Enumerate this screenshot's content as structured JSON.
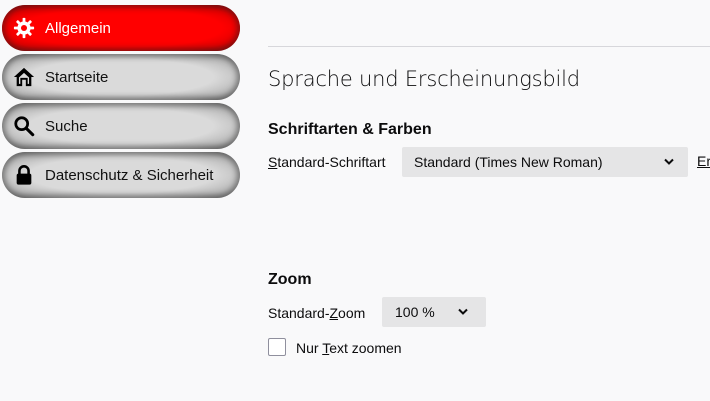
{
  "sidebar": {
    "items": [
      {
        "label": "Allgemein",
        "icon": "gear-icon",
        "active": true
      },
      {
        "label": "Startseite",
        "icon": "home-icon",
        "active": false
      },
      {
        "label": "Suche",
        "icon": "search-icon",
        "active": false
      },
      {
        "label": "Datenschutz & Sicherheit",
        "icon": "lock-icon",
        "active": false
      }
    ]
  },
  "main": {
    "section_title": "Sprache und Erscheinungsbild",
    "fonts": {
      "heading": "Schriftarten & Farben",
      "default_font_label_accesskey": "S",
      "default_font_label_rest": "tandard-Schriftart",
      "default_font_value": "Standard (Times New Roman)",
      "advanced_link": "Er"
    },
    "zoom": {
      "heading": "Zoom",
      "default_zoom_label_pre": "Standard-",
      "default_zoom_label_accesskey": "Z",
      "default_zoom_label_post": "oom",
      "default_zoom_value": "100 %",
      "text_only_label_pre": "Nur ",
      "text_only_label_accesskey": "T",
      "text_only_label_post": "ext zoomen",
      "text_only_checked": false
    }
  },
  "colors": {
    "active_nav": "#ff0000",
    "background": "#f9f9fa",
    "select_bg": "#e5e5e6"
  }
}
